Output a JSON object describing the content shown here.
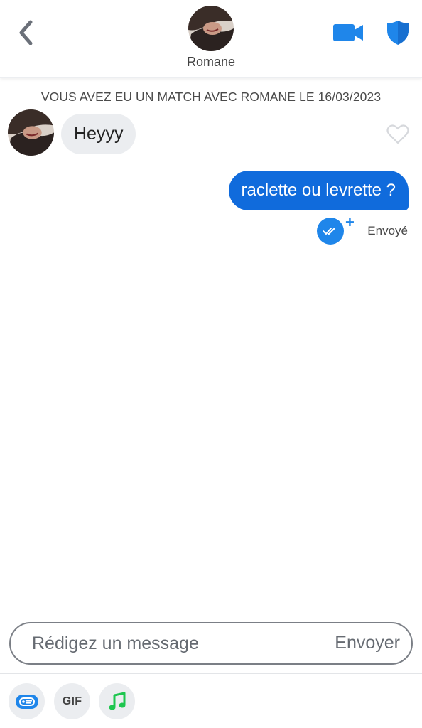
{
  "header": {
    "contact_name": "Romane",
    "icons": {
      "back": "chevron-left-icon",
      "video": "video-camera-icon",
      "safety": "shield-icon"
    }
  },
  "match_banner": "VOUS AVEZ EU UN MATCH AVEC ROMANE LE 16/03/2023",
  "messages": [
    {
      "direction": "incoming",
      "text": "Heyyy"
    },
    {
      "direction": "outgoing",
      "text": "raclette ou levrette ?",
      "status": "Envoyé"
    }
  ],
  "composer": {
    "placeholder": "Rédigez un message",
    "value": "",
    "send_label": "Envoyer"
  },
  "toolbar": {
    "gif_label": "GIF",
    "icons": [
      "sticker-icon",
      "gif-icon",
      "music-note-icon"
    ]
  },
  "colors": {
    "accent": "#106bdc",
    "read_badge": "#1f86ea",
    "incoming_bubble": "#ebedf0",
    "music_green": "#1ec64f"
  }
}
